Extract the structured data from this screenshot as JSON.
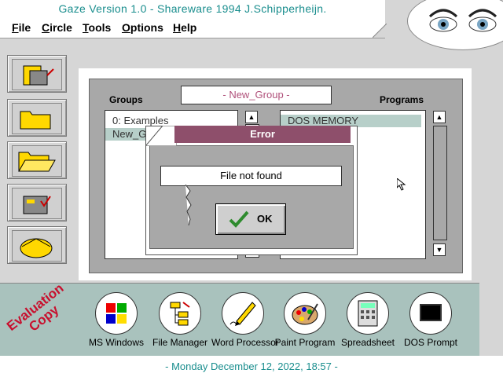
{
  "window": {
    "title": "Gaze Version 1.0 - Shareware 1994 J.Schipperheijn."
  },
  "menu": [
    "File",
    "Circle",
    "Tools",
    "Options",
    "Help"
  ],
  "main": {
    "groups_label": "Groups",
    "programs_label": "Programs",
    "current_group": "- New_Group -",
    "groups": [
      "0: Examples",
      "New_G"
    ],
    "programs": [
      "DOS MEMORY"
    ]
  },
  "error_dialog": {
    "title": "Error",
    "message": "File not found",
    "ok_label": "OK"
  },
  "stamp": {
    "line1": "Evaluation",
    "line2": "Copy"
  },
  "apps": [
    {
      "label": "MS Windows",
      "icon": "windows-icon"
    },
    {
      "label": "File Manager",
      "icon": "file-manager-icon"
    },
    {
      "label": "Word Processor",
      "icon": "pen-icon"
    },
    {
      "label": "Paint Program",
      "icon": "palette-icon"
    },
    {
      "label": "Spreadsheet",
      "icon": "calculator-icon"
    },
    {
      "label": "DOS Prompt",
      "icon": "monitor-icon"
    }
  ],
  "status": {
    "date": "- Monday December 12, 2022, 18:57 -"
  },
  "colors": {
    "accent": "#1a8e8e",
    "dialog_title": "#8e4f6b",
    "toolbar_bg": "#a9c2bd",
    "stamp": "#c8102e"
  }
}
